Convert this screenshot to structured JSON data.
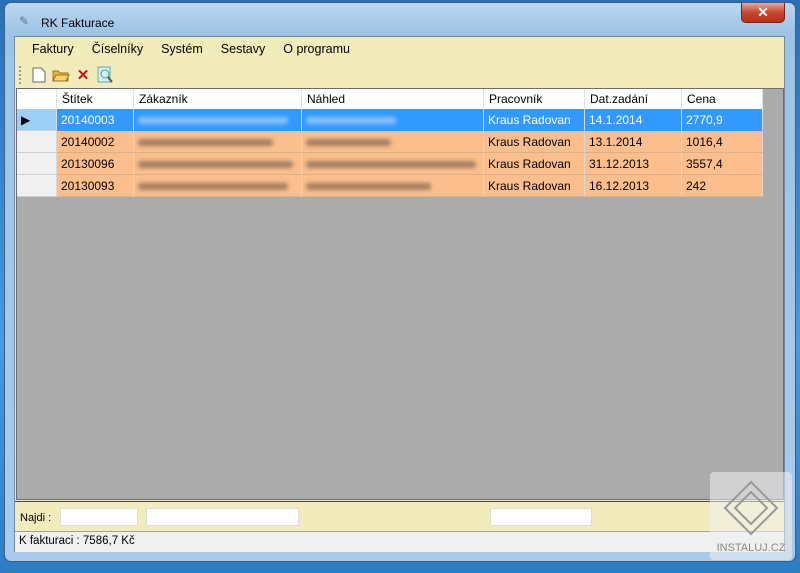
{
  "window": {
    "title": "RK Fakturace",
    "close_label": "✕"
  },
  "menu": [
    "Faktury",
    "Číselníky",
    "Systém",
    "Sestavy",
    "O programu"
  ],
  "toolbar": {
    "icons": [
      "new-document-icon",
      "open-folder-icon",
      "delete-icon",
      "preview-icon"
    ]
  },
  "grid": {
    "columns": [
      "Štítek",
      "Zákazník",
      "Náhled",
      "Pracovník",
      "Dat.zadání",
      "Cena"
    ],
    "rows": [
      {
        "stitek": "20140003",
        "pracovnik": "Kraus Radovan",
        "datum": "14.1.2014",
        "cena": "2770,9",
        "selected": true
      },
      {
        "stitek": "20140002",
        "pracovnik": "Kraus Radovan",
        "datum": "13.1.2014",
        "cena": "1016,4"
      },
      {
        "stitek": "20130096",
        "pracovnik": "Kraus Radovan",
        "datum": "31.12.2013",
        "cena": "3557,4"
      },
      {
        "stitek": "20130093",
        "pracovnik": "Kraus Radovan",
        "datum": "16.12.2013",
        "cena": "242"
      }
    ]
  },
  "find": {
    "label": "Najdi :"
  },
  "status": {
    "text": "K fakturaci : 7586,7 Kč"
  },
  "watermark": "INSTALUJ.CZ",
  "colors": {
    "row": "#fbbe8c",
    "selected": "#3399ff",
    "background": "#f2ecbc",
    "grid_bg": "#ababab"
  }
}
